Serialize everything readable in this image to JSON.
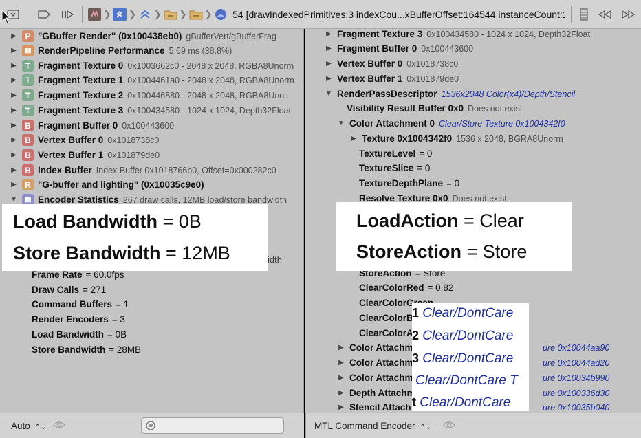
{
  "toolbar": {
    "crumb_label": "54 [drawIndexedPrimitives:3 indexCou...xBufferOffset:164544 instanceCount:1]"
  },
  "left": {
    "rows": [
      {
        "badge": "P",
        "label": "\"GBuffer Render\" (0x100438eb0)",
        "detail": "gBufferVert/gBufferFrag"
      },
      {
        "badge": "perf",
        "label": "RenderPipeline Performance",
        "detail": "5.69 ms (38.8%)"
      },
      {
        "badge": "T",
        "label": "Fragment Texture 0",
        "detail": "0x1003662c0 - 2048 x 2048, RGBA8Unorm"
      },
      {
        "badge": "T",
        "label": "Fragment Texture 1",
        "detail": "0x1004461a0 - 2048 x 2048, RGBA8Unorm"
      },
      {
        "badge": "T",
        "label": "Fragment Texture 2",
        "detail": "0x100446880 - 2048 x 2048, RGBA8Uno..."
      },
      {
        "badge": "T",
        "label": "Fragment Texture 3",
        "detail": "0x100434580 - 1024 x 1024, Depth32Float"
      },
      {
        "badge": "B",
        "label": "Fragment Buffer 0",
        "detail": "0x100443600"
      },
      {
        "badge": "B",
        "label": "Vertex Buffer 0",
        "detail": "0x1018738c0"
      },
      {
        "badge": "B",
        "label": "Vertex Buffer 1",
        "detail": "0x101879de0"
      },
      {
        "badge": "B",
        "label": "Index Buffer",
        "detail": "Index Buffer 0x1018766b0, Offset=0x000282c0"
      },
      {
        "badge": "R",
        "label": "\"G-buffer and lighting\" (0x10035c9e0)",
        "detail": ""
      },
      {
        "badge": "stat",
        "label": "Encoder Statistics",
        "detail": "267 draw calls, 12MB load/store bandwidth"
      }
    ],
    "hidden_fragment": "idth",
    "stats": [
      {
        "label": "Frame Rate",
        "value": "= 60.0fps"
      },
      {
        "label": "Draw Calls",
        "value": "= 271"
      },
      {
        "label": "Command Buffers",
        "value": "= 1"
      },
      {
        "label": "Render Encoders",
        "value": "= 3"
      },
      {
        "label": "Load Bandwidth",
        "value": "= 0B"
      },
      {
        "label": "Store Bandwidth",
        "value": "= 28MB"
      }
    ],
    "footer": {
      "mode": "Auto",
      "mode_arrows": "⌃⌄"
    }
  },
  "right": {
    "top_rows": [
      {
        "label": "Fragment Texture 3",
        "detail": "0x100434580 - 1024 x 1024, Depth32Float"
      },
      {
        "label": "Fragment Buffer 0",
        "detail": "0x100443600"
      },
      {
        "label": "Vertex Buffer 0",
        "detail": "0x1018738c0"
      },
      {
        "label": "Vertex Buffer 1",
        "detail": "0x101879de0"
      }
    ],
    "rpd": {
      "label": "RenderPassDescriptor",
      "link": "1536x2048 Color(x4)/Depth/Stencil"
    },
    "visibility": {
      "label": "Visibility Result Buffer 0x0",
      "detail": "Does not exist"
    },
    "color0": {
      "label": "Color Attachment 0",
      "link": "Clear/Store Texture 0x1004342f0"
    },
    "texture": {
      "label": "Texture 0x1004342f0",
      "detail": "1536 x 2048, BGRA8Unorm"
    },
    "props": [
      {
        "label": "TextureLevel",
        "value": "= 0"
      },
      {
        "label": "TextureSlice",
        "value": "= 0"
      },
      {
        "label": "TextureDepthPlane",
        "value": "= 0"
      }
    ],
    "resolve": {
      "label": "Resolve Texture 0x0",
      "detail": "Does not exist"
    },
    "store_action": {
      "label": "StoreAction",
      "value": "= Store"
    },
    "clear_red": {
      "label": "ClearColorRed",
      "value": "= 0.82"
    },
    "partial_rows": [
      "ClearColorGreen",
      "ClearColorBlue",
      "ClearColorAlpha"
    ],
    "attachments": [
      {
        "label": "Color Attachm",
        "link": "ure 0x10044aa90"
      },
      {
        "label": "Color Attachm",
        "link": "ure 0x10044ad20"
      },
      {
        "label": "Color Attachm",
        "link": "ure 0x10034b990"
      },
      {
        "label": "Depth Attachm",
        "link": "ure 0x100336d30"
      },
      {
        "label": "Stencil Attach",
        "link": "ure 0x10035b040"
      }
    ],
    "footer": {
      "mode": "MTL Command Encoder",
      "mode_arrows": "⌃⌄"
    }
  },
  "callouts": {
    "load_bw": {
      "label": "Load Bandwidth",
      "value": "= 0B"
    },
    "store_bw": {
      "label": "Store Bandwidth",
      "value": "= 12MB"
    },
    "load_action": {
      "label": "LoadAction",
      "value": "= Clear"
    },
    "store_action": {
      "label": "StoreAction",
      "value": "= Store"
    },
    "dontcare": [
      {
        "num": "1",
        "text": "Clear/DontCare"
      },
      {
        "num": "2",
        "text": "Clear/DontCare"
      },
      {
        "num": "3",
        "text": "Clear/DontCare"
      },
      {
        "num": "",
        "text": "Clear/DontCare T"
      },
      {
        "num": "t",
        "text": "Clear/DontCare"
      }
    ]
  }
}
